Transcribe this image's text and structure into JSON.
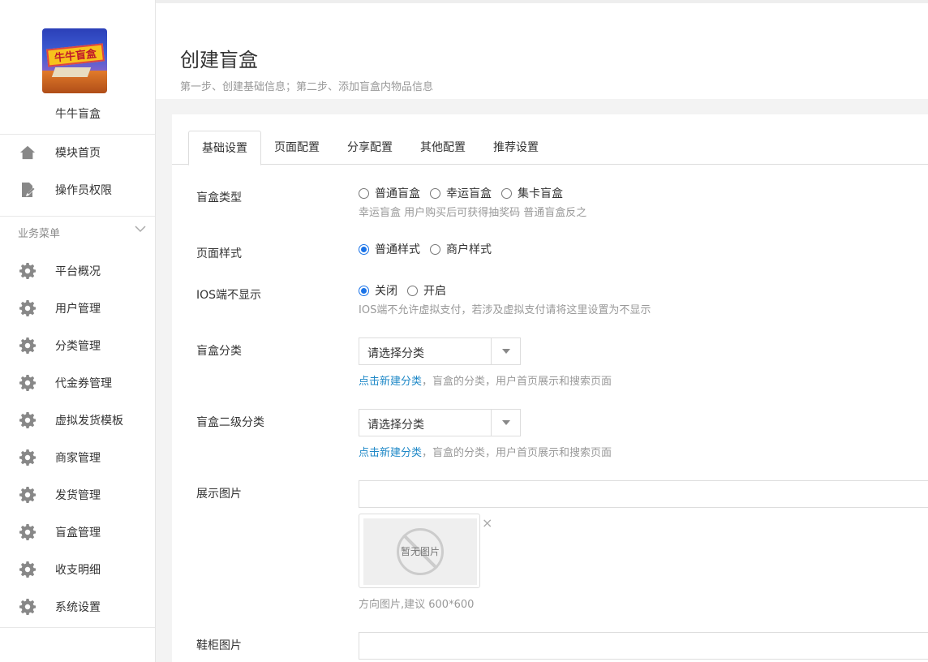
{
  "app": {
    "name": "牛牛盲盒",
    "logo_text": "牛牛盲盒"
  },
  "sidebar": {
    "top_items": [
      {
        "label": "模块首页",
        "icon": "home-icon"
      },
      {
        "label": "操作员权限",
        "icon": "document-edit-icon"
      }
    ],
    "section_label": "业务菜单",
    "items": [
      {
        "label": "平台概况",
        "icon": "gear-icon"
      },
      {
        "label": "用户管理",
        "icon": "gear-icon"
      },
      {
        "label": "分类管理",
        "icon": "gear-icon"
      },
      {
        "label": "代金券管理",
        "icon": "gear-icon"
      },
      {
        "label": "虚拟发货模板",
        "icon": "gear-icon"
      },
      {
        "label": "商家管理",
        "icon": "gear-icon"
      },
      {
        "label": "发货管理",
        "icon": "gear-icon"
      },
      {
        "label": "盲盒管理",
        "icon": "gear-icon"
      },
      {
        "label": "收支明细",
        "icon": "gear-icon"
      },
      {
        "label": "系统设置",
        "icon": "gear-icon"
      }
    ]
  },
  "header": {
    "title": "创建盲盒",
    "subtitle": "第一步、创建基础信息；第二步、添加盲盒内物品信息"
  },
  "tabs": [
    {
      "label": "基础设置",
      "active": true
    },
    {
      "label": "页面配置",
      "active": false
    },
    {
      "label": "分享配置",
      "active": false
    },
    {
      "label": "其他配置",
      "active": false
    },
    {
      "label": "推荐设置",
      "active": false
    }
  ],
  "form": {
    "box_type": {
      "label": "盲盒类型",
      "options": [
        "普通盲盒",
        "幸运盲盒",
        "集卡盲盒"
      ],
      "selected": null,
      "help": "幸运盲盒 用户购买后可获得抽奖码 普通盲盒反之"
    },
    "page_style": {
      "label": "页面样式",
      "options": [
        "普通样式",
        "商户样式"
      ],
      "selected": "普通样式"
    },
    "ios_hide": {
      "label": "IOS端不显示",
      "options": [
        "关闭",
        "开启"
      ],
      "selected": "关闭",
      "help": "IOS端不允许虚拟支付，若涉及虚拟支付请将这里设置为不显示"
    },
    "category": {
      "label": "盲盒分类",
      "value": "请选择分类",
      "help_link": "点击新建分类",
      "help_text": "，盲盒的分类，用户首页展示和搜索页面"
    },
    "sub_category": {
      "label": "盲盒二级分类",
      "value": "请选择分类",
      "help_link": "点击新建分类",
      "help_text": "，盲盒的分类，用户首页展示和搜索页面"
    },
    "display_image": {
      "label": "展示图片",
      "value": "",
      "placeholder_text": "暂无图片",
      "close": "×",
      "help": "方向图片,建议 600*600"
    },
    "cabinet_image": {
      "label": "鞋柜图片",
      "value": ""
    }
  },
  "colors": {
    "accent": "#1a73e8",
    "link": "#1e88c7",
    "help": "#999999"
  }
}
